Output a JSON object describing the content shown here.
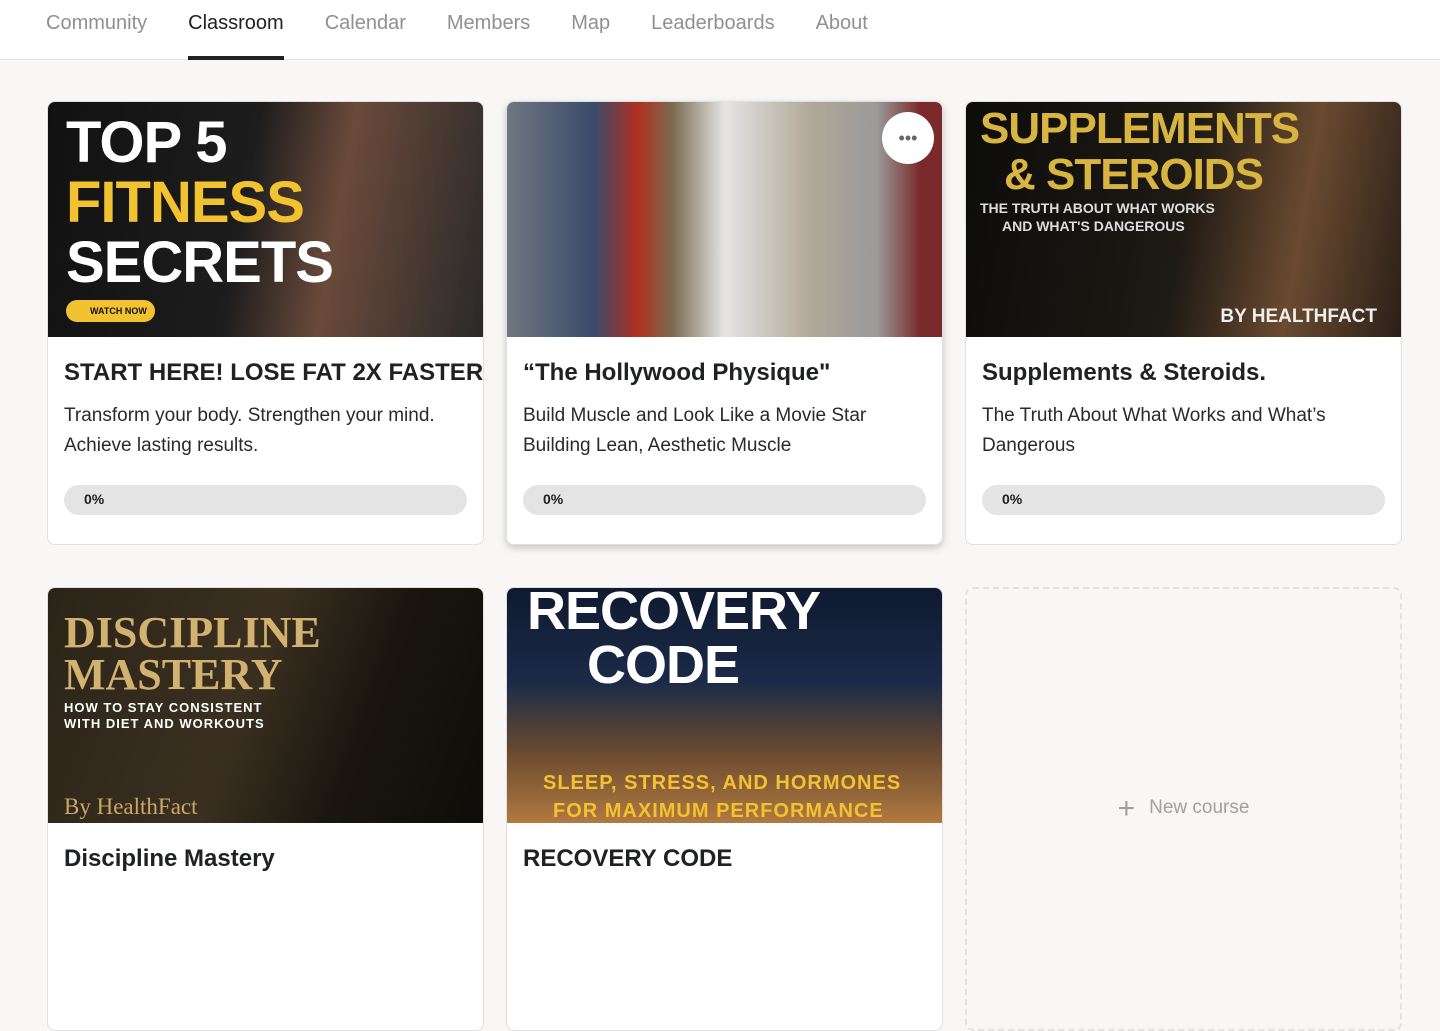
{
  "nav": {
    "tabs": [
      {
        "label": "Community"
      },
      {
        "label": "Classroom",
        "active": true
      },
      {
        "label": "Calendar"
      },
      {
        "label": "Members"
      },
      {
        "label": "Map"
      },
      {
        "label": "Leaderboards"
      },
      {
        "label": "About"
      }
    ]
  },
  "courses": [
    {
      "title": "START HERE! LOSE FAT 2X FASTER",
      "desc1": "Transform your body. Strengthen your mind.",
      "desc2": "Achieve lasting results.",
      "progress": "0%",
      "thumb_text": [
        "TOP 5",
        "FITNESS",
        "SECRETS",
        "WATCH NOW"
      ]
    },
    {
      "title": "“The Hollywood Physique\"",
      "desc1": "Build Muscle and Look Like a Movie Star",
      "desc2": "Building Lean, Aesthetic Muscle",
      "progress": "0%",
      "more_icon": "•••"
    },
    {
      "title": "Supplements & Steroids.",
      "desc1": "The Truth About What Works and What’s",
      "desc2": "Dangerous",
      "progress": "0%",
      "thumb_text": [
        "SUPPLEMENTS",
        "& STEROIDS",
        "THE TRUTH ABOUT WHAT WORKS",
        "AND WHAT'S DANGEROUS",
        "BY HEALTHFACT"
      ]
    },
    {
      "title": "Discipline Mastery",
      "thumb_text": [
        "DISCIPLINE",
        "MASTERY",
        "HOW TO STAY CONSISTENT",
        "WITH DIET AND WORKOUTS",
        "By HealthFact"
      ]
    },
    {
      "title": "RECOVERY CODE",
      "thumb_text": [
        "RECOVERY",
        "CODE",
        "SLEEP, STRESS, AND HORMONES",
        "FOR MAXIMUM PERFORMANCE"
      ]
    }
  ],
  "new_course": {
    "icon": "+",
    "label": "New course"
  },
  "colors": {
    "accent": "#202124",
    "gold": "#f2c230"
  }
}
